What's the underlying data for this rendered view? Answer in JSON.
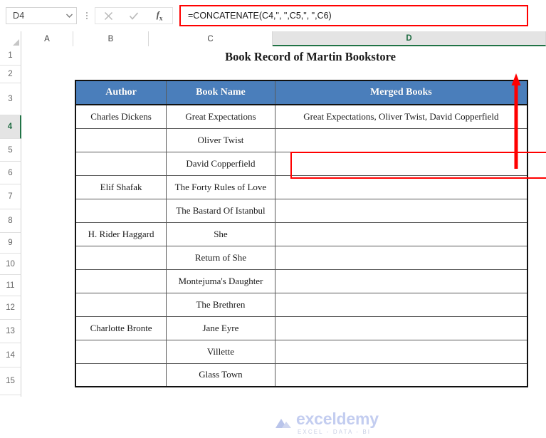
{
  "formula_bar": {
    "name_box_value": "D4",
    "formula": "=CONCATENATE(C4,\", \",C5,\", \",C6)",
    "cancel_icon": "close-icon",
    "enter_icon": "check-icon",
    "function_icon": "fx-icon",
    "function_label": "f",
    "function_label_sub": "x",
    "accent_color": "#ff0000"
  },
  "grid": {
    "columns": [
      "A",
      "B",
      "C",
      "D"
    ],
    "selected_column": "D",
    "rows": [
      "1",
      "2",
      "3",
      "4",
      "5",
      "6",
      "7",
      "8",
      "9",
      "10",
      "11",
      "12",
      "13",
      "14",
      "15"
    ],
    "selected_row": "4",
    "selection_color": "#217346"
  },
  "sheet": {
    "title": "Book Record of Martin Bookstore",
    "header_fill": "#4a7ebb",
    "headers": [
      "Author",
      "Book Name",
      "Merged Books"
    ],
    "rows": [
      {
        "author": "Charles Dickens",
        "book": "Great Expectations",
        "merged": "Great Expectations, Oliver Twist, David Copperfield"
      },
      {
        "author": "",
        "book": "Oliver Twist",
        "merged": ""
      },
      {
        "author": "",
        "book": "David Copperfield",
        "merged": ""
      },
      {
        "author": "Elif Shafak",
        "book": "The Forty Rules of Love",
        "merged": ""
      },
      {
        "author": "",
        "book": "The Bastard Of Istanbul",
        "merged": ""
      },
      {
        "author": "H. Rider Haggard",
        "book": "She",
        "merged": ""
      },
      {
        "author": "",
        "book": "Return of She",
        "merged": ""
      },
      {
        "author": "",
        "book": "Montejuma's Daughter",
        "merged": ""
      },
      {
        "author": "",
        "book": "The Brethren",
        "merged": ""
      },
      {
        "author": "Charlotte Bronte",
        "book": "Jane Eyre",
        "merged": ""
      },
      {
        "author": "",
        "book": "Villette",
        "merged": ""
      },
      {
        "author": "",
        "book": "Glass Town",
        "merged": ""
      }
    ]
  },
  "annotation": {
    "arrow_color": "#ff0000",
    "highlight_color": "#ff0000"
  },
  "watermark": {
    "main": "exceldemy",
    "sub": "EXCEL - DATA - BI"
  }
}
